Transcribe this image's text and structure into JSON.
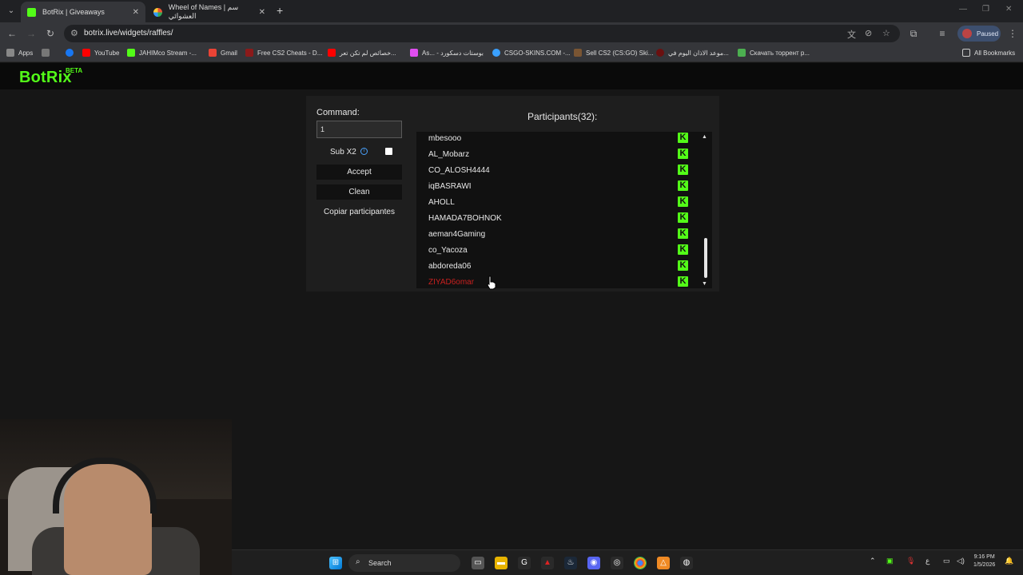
{
  "browser": {
    "tabs": [
      {
        "title": "BotRix | Giveaways"
      },
      {
        "title": "Wheel of Names | سم العشوائي"
      }
    ],
    "url": "botrix.live/widgets/raffles/",
    "profile_label": "Paused"
  },
  "bookmarks": [
    {
      "label": "Apps"
    },
    {
      "label": "YouTube"
    },
    {
      "label": "JAHIMco Stream -..."
    },
    {
      "label": "Gmail"
    },
    {
      "label": "Free CS2 Cheats - D..."
    },
    {
      "label": "خصائص لم تكن تعر..."
    },
    {
      "label": "As... - بوستات دسكورد"
    },
    {
      "label": "CSGO-SKINS.COM -..."
    },
    {
      "label": "Sell CS2 (CS:GO) Ski..."
    },
    {
      "label": "موعد الاذان اليوم في..."
    },
    {
      "label": "Скачать торрент р..."
    },
    {
      "label": "All Bookmarks"
    }
  ],
  "app": {
    "logo": "BotRix",
    "beta": "BETA"
  },
  "raffle": {
    "command_label": "Command:",
    "command_value": "1",
    "sub_x2_label": "Sub X2",
    "sub_x2_checked": false,
    "accept_label": "Accept",
    "clean_label": "Clean",
    "copy_label": "Copiar participantes",
    "participants_title": "Participants(32):",
    "participants": [
      {
        "name": "mbesooo",
        "highlight": false
      },
      {
        "name": "AL_Mobarz",
        "highlight": false
      },
      {
        "name": "CO_ALOSH4444",
        "highlight": false
      },
      {
        "name": "iqBASRAWI",
        "highlight": false
      },
      {
        "name": "AHOLL",
        "highlight": false
      },
      {
        "name": "HAMADA7BOHNOK",
        "highlight": false
      },
      {
        "name": "aeman4Gaming",
        "highlight": false
      },
      {
        "name": "co_Yacoza",
        "highlight": false
      },
      {
        "name": "abdoreda06",
        "highlight": false
      },
      {
        "name": "ZIYAD6omar",
        "highlight": true
      }
    ],
    "platform_icon": "kick-icon",
    "accent_color": "#53fc18",
    "highlight_color": "#c8201f"
  },
  "taskbar": {
    "search_label": "Search",
    "time": "9:16 PM",
    "date": "1/5/2026",
    "lang": "ع"
  }
}
